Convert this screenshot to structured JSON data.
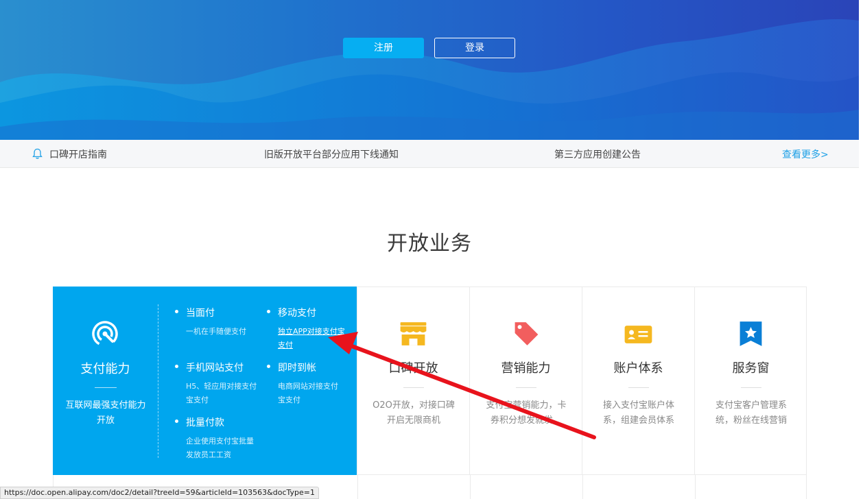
{
  "hero": {
    "register_label": "注册",
    "login_label": "登录"
  },
  "notices": {
    "items": [
      "口碑开店指南",
      "旧版开放平台部分应用下线通知",
      "第三方应用创建公告"
    ],
    "more": "查看更多>"
  },
  "section": {
    "title": "开放业务"
  },
  "featured": {
    "title": "支付能力",
    "desc": "互联网最强支付能力开放",
    "icon": "payment-signal-icon",
    "subs": [
      {
        "name": "当面付",
        "desc": "一机在手随便支付"
      },
      {
        "name": "移动支付",
        "desc": "独立APP对接支付宝支付"
      },
      {
        "name": "手机网站支付",
        "desc": "H5、轻应用对接支付宝支付"
      },
      {
        "name": "即时到帐",
        "desc": "电商网站对接支付宝支付"
      },
      {
        "name": "批量付款",
        "desc": "企业使用支付宝批量发放员工工资"
      }
    ]
  },
  "cards": [
    {
      "title": "口碑开放",
      "desc": "O2O开放，对接口碑开启无限商机",
      "icon": "storefront-icon",
      "color": "#f5b820"
    },
    {
      "title": "营销能力",
      "desc": "支付宝营销能力，卡券积分想发就发。",
      "icon": "price-tag-icon",
      "color": "#f25e5e"
    },
    {
      "title": "账户体系",
      "desc": "接入支付宝账户体系，组建会员体系",
      "icon": "id-card-icon",
      "color": "#f5b820"
    },
    {
      "title": "服务窗",
      "desc": "支付宝客户管理系统，粉丝在线营销",
      "icon": "star-bookmark-icon",
      "color": "#0a7fd6"
    }
  ],
  "status_bar": {
    "url": "https://doc.open.alipay.com/doc2/detail?treeId=59&articleId=103563&docType=1"
  },
  "colors": {
    "accent": "#00a6ee",
    "annotation_arrow": "#e8131c"
  }
}
